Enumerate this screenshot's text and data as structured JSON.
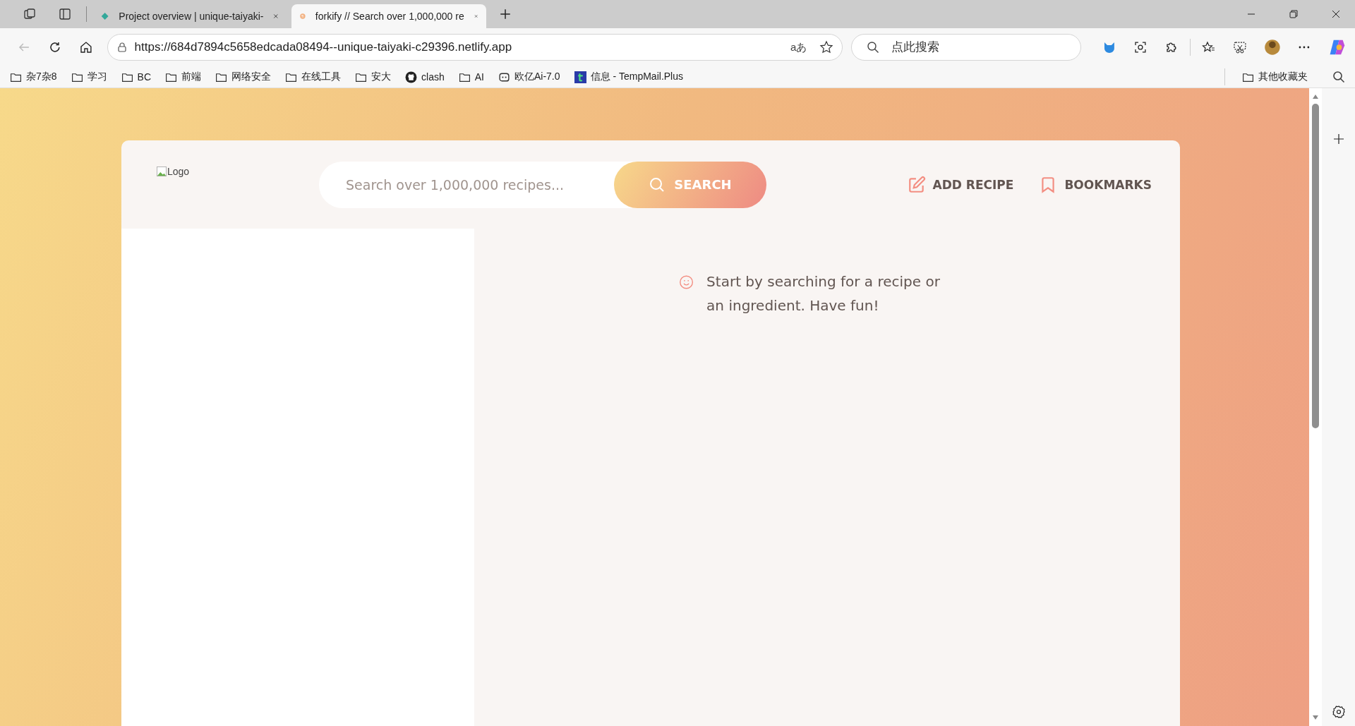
{
  "browser": {
    "tabs": [
      {
        "title": "Project overview | unique-taiyaki-",
        "kind": "netlify",
        "selected": false
      },
      {
        "title": "forkify // Search over 1,000,000 re",
        "kind": "forkify",
        "selected": true
      }
    ],
    "address": "https://684d7894c5658edcada08494--unique-taiyaki-c29396.netlify.app",
    "translate_text": "aあ",
    "search_placeholder": "点此搜索",
    "bookmarks": [
      {
        "label": "杂7杂8",
        "kind": "folder"
      },
      {
        "label": "学习",
        "kind": "folder"
      },
      {
        "label": "BC",
        "kind": "folder"
      },
      {
        "label": "前端",
        "kind": "folder"
      },
      {
        "label": "网络安全",
        "kind": "folder"
      },
      {
        "label": "在线工具",
        "kind": "folder"
      },
      {
        "label": "安大",
        "kind": "folder"
      },
      {
        "label": "clash",
        "kind": "github"
      },
      {
        "label": "AI",
        "kind": "folder"
      },
      {
        "label": "欧亿Ai-7.0",
        "kind": "bot"
      },
      {
        "label": "信息 - TempMail.Plus",
        "kind": "tempmail"
      }
    ],
    "other_bookmarks": "其他收藏夹"
  },
  "app": {
    "logo_alt": "Logo",
    "search": {
      "placeholder": "Search over 1,000,000 recipes..."
    },
    "search_button": "SEARCH",
    "nav": [
      {
        "label": "ADD RECIPE",
        "kind": "edit"
      },
      {
        "label": "BOOKMARKS",
        "kind": "bookmark"
      }
    ],
    "message": "Start by searching for a recipe or an ingredient. Have fun!"
  }
}
